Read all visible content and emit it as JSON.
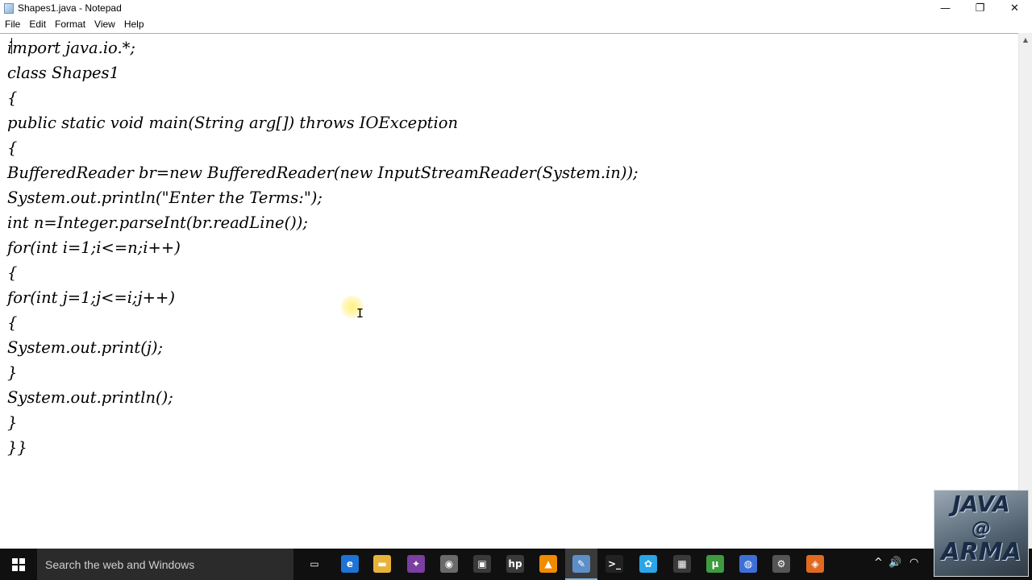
{
  "window": {
    "title": "Shapes1.java - Notepad",
    "controls": {
      "minimize": "—",
      "restore": "❐",
      "close": "✕"
    }
  },
  "menu": {
    "items": [
      {
        "label": "File"
      },
      {
        "label": "Edit"
      },
      {
        "label": "Format"
      },
      {
        "label": "View"
      },
      {
        "label": "Help"
      }
    ]
  },
  "editor": {
    "lines": [
      "import java.io.*;",
      "class Shapes1",
      "{",
      "public static void main(String arg[]) throws IOException",
      "{",
      "BufferedReader br=new BufferedReader(new InputStreamReader(System.in));",
      "System.out.println(\"Enter the Terms:\");",
      "int n=Integer.parseInt(br.readLine());",
      "for(int i=1;i<=n;i++)",
      "{",
      "for(int j=1;j<=i;j++)",
      "{",
      "System.out.print(j);",
      "}",
      "System.out.println();",
      "}",
      "}}"
    ]
  },
  "taskbar": {
    "search_placeholder": "Search the web and Windows",
    "icons": [
      {
        "name": "task-view",
        "glyph": "▭",
        "color": "#101010"
      },
      {
        "name": "edge",
        "glyph": "e",
        "color": "#1e73d6"
      },
      {
        "name": "file-explorer",
        "glyph": "▬",
        "color": "#e8b23a"
      },
      {
        "name": "app-1",
        "glyph": "✦",
        "color": "#7a3fa0"
      },
      {
        "name": "chrome",
        "glyph": "◉",
        "color": "#6a6a6a"
      },
      {
        "name": "store",
        "glyph": "▣",
        "color": "#3a3a3a"
      },
      {
        "name": "hp",
        "glyph": "hp",
        "color": "#3a3a3a"
      },
      {
        "name": "vlc",
        "glyph": "▲",
        "color": "#f08a00"
      },
      {
        "name": "notepad",
        "glyph": "✎",
        "color": "#5c8fc7"
      },
      {
        "name": "cmd",
        "glyph": ">_",
        "color": "#222222"
      },
      {
        "name": "app-2",
        "glyph": "✿",
        "color": "#2aa5e8"
      },
      {
        "name": "calculator",
        "glyph": "▦",
        "color": "#3a3a3a"
      },
      {
        "name": "utorrent",
        "glyph": "µ",
        "color": "#3e9b3e"
      },
      {
        "name": "app-3",
        "glyph": "◍",
        "color": "#3e6fd6"
      },
      {
        "name": "app-4",
        "glyph": "⚙",
        "color": "#555555"
      },
      {
        "name": "app-5",
        "glyph": "◈",
        "color": "#e06a20"
      }
    ]
  },
  "tray": {
    "chevron": "^",
    "volume": "🔊",
    "network": "◠"
  },
  "watermark": {
    "line1": "JAVA",
    "line2": "@",
    "line3": "ARMA"
  }
}
